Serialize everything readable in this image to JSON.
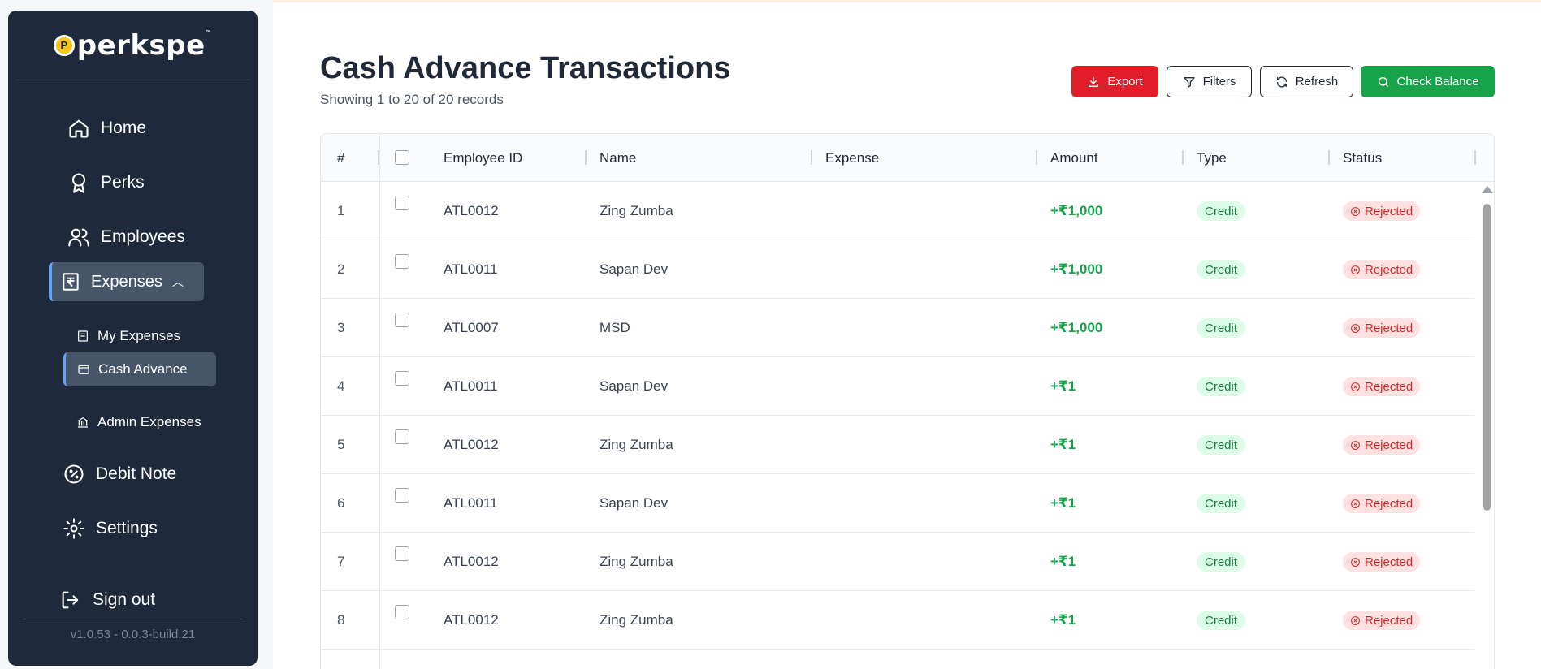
{
  "brand": {
    "logo_text": "perkspe",
    "logo_tm": "™",
    "logo_mark": "P"
  },
  "sidebar": {
    "home": "Home",
    "perks": "Perks",
    "employees": "Employees",
    "expenses": "Expenses",
    "sub": {
      "my_expenses": "My Expenses",
      "cash_advance": "Cash Advance",
      "admin_expenses": "Admin Expenses"
    },
    "debit_note": "Debit Note",
    "settings": "Settings",
    "sign_out": "Sign out",
    "version": "v1.0.53 - 0.0.3-build.21"
  },
  "header": {
    "title": "Cash Advance Transactions",
    "subtitle": "Showing 1 to 20 of 20 records"
  },
  "toolbar": {
    "export": "Export",
    "filters": "Filters",
    "refresh": "Refresh",
    "check_balance": "Check Balance"
  },
  "table": {
    "columns": {
      "index": "#",
      "employee_id": "Employee ID",
      "name": "Name",
      "expense": "Expense",
      "amount": "Amount",
      "type": "Type",
      "status": "Status"
    },
    "rows": [
      {
        "index": "1",
        "employee_id": "ATL0012",
        "name": "Zing Zumba",
        "expense": "",
        "amount": "+₹1,000",
        "type": "Credit",
        "status": "Rejected"
      },
      {
        "index": "2",
        "employee_id": "ATL0011",
        "name": "Sapan Dev",
        "expense": "",
        "amount": "+₹1,000",
        "type": "Credit",
        "status": "Rejected"
      },
      {
        "index": "3",
        "employee_id": "ATL0007",
        "name": "MSD",
        "expense": "",
        "amount": "+₹1,000",
        "type": "Credit",
        "status": "Rejected"
      },
      {
        "index": "4",
        "employee_id": "ATL0011",
        "name": "Sapan Dev",
        "expense": "",
        "amount": "+₹1",
        "type": "Credit",
        "status": "Rejected"
      },
      {
        "index": "5",
        "employee_id": "ATL0012",
        "name": "Zing Zumba",
        "expense": "",
        "amount": "+₹1",
        "type": "Credit",
        "status": "Rejected"
      },
      {
        "index": "6",
        "employee_id": "ATL0011",
        "name": "Sapan Dev",
        "expense": "",
        "amount": "+₹1",
        "type": "Credit",
        "status": "Rejected"
      },
      {
        "index": "7",
        "employee_id": "ATL0012",
        "name": "Zing Zumba",
        "expense": "",
        "amount": "+₹1",
        "type": "Credit",
        "status": "Rejected"
      },
      {
        "index": "8",
        "employee_id": "ATL0012",
        "name": "Zing Zumba",
        "expense": "",
        "amount": "+₹1",
        "type": "Credit",
        "status": "Rejected"
      }
    ]
  },
  "colors": {
    "sidebar_bg": "#1e293b",
    "export": "#e11d2a",
    "check_balance": "#16a34a",
    "credit_badge": "#dcfce7",
    "rejected_badge": "#fee2e2"
  }
}
